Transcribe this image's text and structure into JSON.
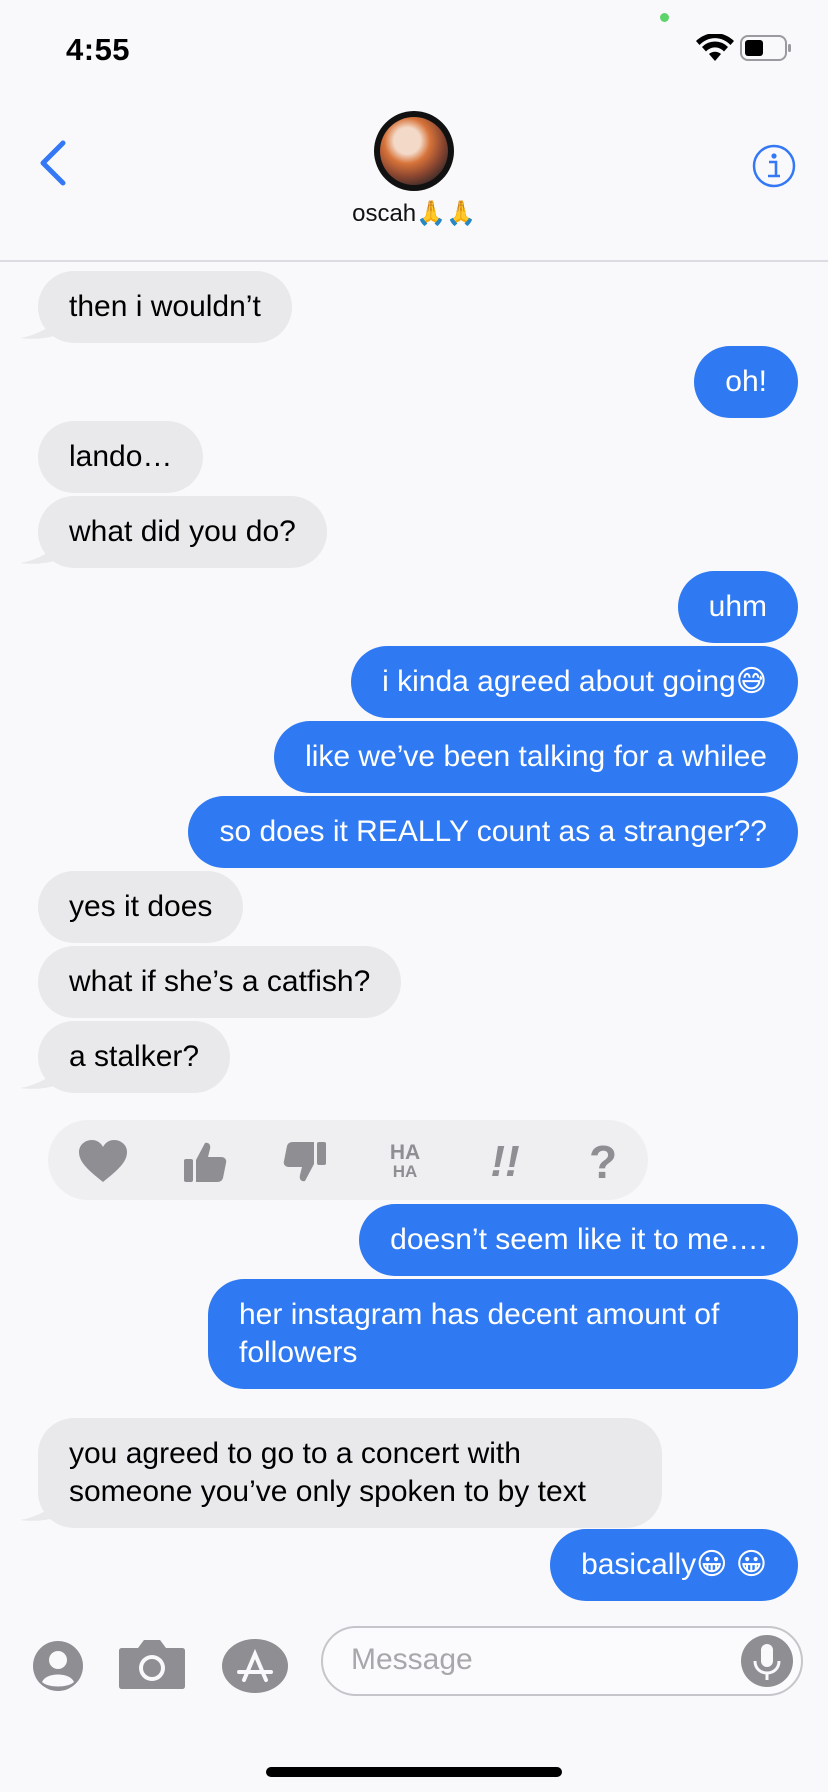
{
  "status": {
    "time": "4:55"
  },
  "header": {
    "contact_name": "oscah🙏🙏"
  },
  "messages": [
    {
      "from": "them",
      "text": "then i wouldn’t"
    },
    {
      "from": "me",
      "text": "oh!"
    },
    {
      "from": "them",
      "text": "lando…"
    },
    {
      "from": "them",
      "text": "what did you do?"
    },
    {
      "from": "me",
      "text": "uhm"
    },
    {
      "from": "me",
      "text": "i kinda agreed about going😅"
    },
    {
      "from": "me",
      "text": "like we’ve been talking for a whilee"
    },
    {
      "from": "me",
      "text": "so does it REALLY count as a stranger??"
    },
    {
      "from": "them",
      "text": "yes it does"
    },
    {
      "from": "them",
      "text": "what if she’s a catfish?"
    },
    {
      "from": "them",
      "text": "a stalker?"
    },
    {
      "from": "me",
      "text": "doesn’t seem like it to me…."
    },
    {
      "from": "me",
      "text": "her instagram has decent amount of followers"
    },
    {
      "from": "them",
      "text": "you agreed to go to a concert with someone you’ve only spoken to by text"
    },
    {
      "from": "me",
      "text": "basically😀 😀"
    }
  ],
  "tapbacks": [
    "heart-icon",
    "thumbs-up-icon",
    "thumbs-down-icon",
    "haha-icon",
    "exclamation-icon",
    "question-icon"
  ],
  "tapback_labels": {
    "haha_top": "HA",
    "haha_bottom": "HA",
    "emphasis": "!!",
    "question": "?"
  },
  "input": {
    "placeholder": "Message"
  },
  "colors": {
    "outgoing": "#2f7af3",
    "incoming": "#e9e9eb",
    "accent": "#3478f6"
  }
}
